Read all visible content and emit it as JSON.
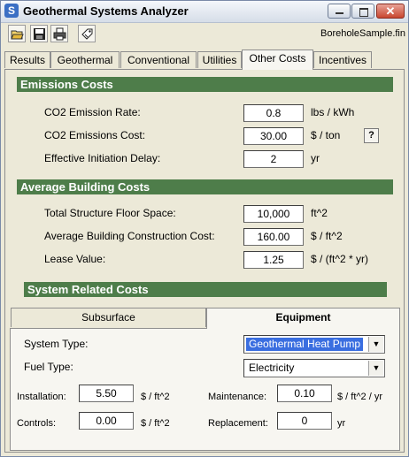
{
  "window": {
    "title": "Geothermal Systems Analyzer",
    "filename": "BoreholeSample.fin",
    "icon": "app-logo-icon"
  },
  "toolbar": {
    "icons": [
      "open-folder-icon",
      "save-disk-icon",
      "printer-icon",
      "tag-icon"
    ]
  },
  "tabs": [
    {
      "label": "Results",
      "active": false
    },
    {
      "label": "Geothermal",
      "active": false
    },
    {
      "label": "Conventional",
      "active": false
    },
    {
      "label": "Utilities",
      "active": false
    },
    {
      "label": "Other Costs",
      "active": true
    },
    {
      "label": "Incentives",
      "active": false
    }
  ],
  "emissions": {
    "heading": "Emissions Costs",
    "rate_label": "CO2 Emission Rate:",
    "rate_value": "0.8",
    "rate_unit": "lbs / kWh",
    "cost_label": "CO2 Emissions Cost:",
    "cost_value": "30.00",
    "cost_unit": "$ / ton",
    "help_label": "?",
    "delay_label": "Effective Initiation Delay:",
    "delay_value": "2",
    "delay_unit": "yr"
  },
  "building": {
    "heading": "Average Building Costs",
    "floor_label": "Total Structure Floor Space:",
    "floor_value": "10,000",
    "floor_unit": "ft^2",
    "construction_label": "Average Building Construction Cost:",
    "construction_value": "160.00",
    "construction_unit": "$ / ft^2",
    "lease_label": "Lease Value:",
    "lease_value": "1.25",
    "lease_unit": "$ / (ft^2 * yr)"
  },
  "system": {
    "heading": "System Related Costs",
    "subtabs": [
      {
        "label": "Subsurface",
        "active": false
      },
      {
        "label": "Equipment",
        "active": true
      }
    ],
    "type_label": "System Type:",
    "type_value": "Geothermal Heat Pump",
    "fuel_label": "Fuel Type:",
    "fuel_value": "Electricity",
    "installation_label": "Installation:",
    "installation_value": "5.50",
    "installation_unit": "$ / ft^2",
    "maintenance_label": "Maintenance:",
    "maintenance_value": "0.10",
    "maintenance_unit": "$ / ft^2 / yr",
    "controls_label": "Controls:",
    "controls_value": "0.00",
    "controls_unit": "$ / ft^2",
    "replacement_label": "Replacement:",
    "replacement_value": "0",
    "replacement_unit": "yr"
  },
  "colors": {
    "section_bar": "#4e7d4a",
    "selection": "#3a6ee0",
    "close_button": "#c9462f"
  }
}
